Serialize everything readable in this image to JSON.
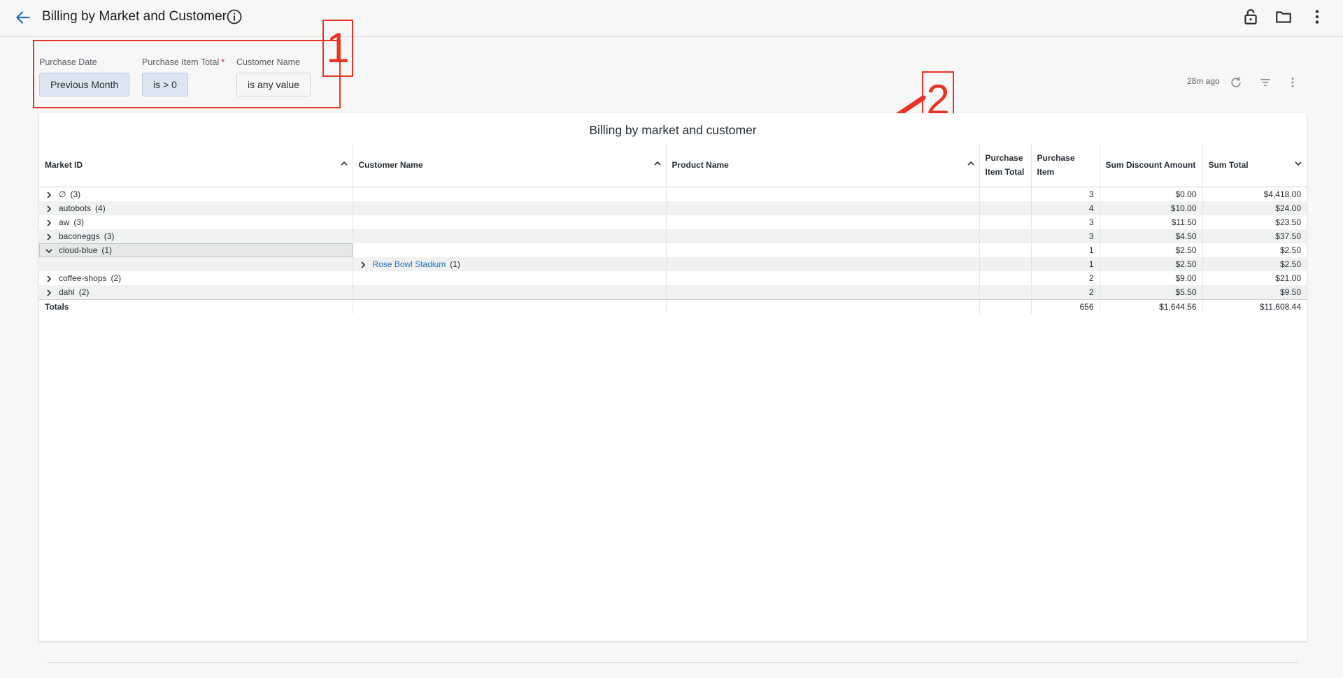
{
  "header": {
    "title": "Billing by Market and Customer",
    "icons": [
      "back-arrow-icon",
      "info-icon",
      "lock-open-icon",
      "folder-icon",
      "more-vertical-icon"
    ]
  },
  "filters": [
    {
      "label": "Purchase Date",
      "value": "Previous Month",
      "required": false,
      "active": true
    },
    {
      "label": "Purchase Item Total",
      "value": "is > 0",
      "required": true,
      "active": true
    },
    {
      "label": "Customer Name",
      "value": "is any value",
      "required": false,
      "active": false
    }
  ],
  "required_mark": "*",
  "annotations": {
    "one": "1",
    "two": "2"
  },
  "toolbar": {
    "updated": "28m ago",
    "icons": [
      "refresh-icon",
      "filter-icon",
      "more-vertical-icon"
    ]
  },
  "table": {
    "title": "Billing by market and customer",
    "columns": [
      "Market ID",
      "Customer Name",
      "Product Name",
      "Purchase Item Total",
      "Purchase Item",
      "Sum Discount Amount",
      "Sum Total"
    ],
    "rows": [
      {
        "market": "∅",
        "count": "(3)",
        "customer": "",
        "customer_count": "",
        "product": "",
        "pit": "",
        "items": "3",
        "discount": "$0.00",
        "total": "$4,418.00"
      },
      {
        "market": "autobots",
        "count": "(4)",
        "customer": "",
        "customer_count": "",
        "product": "",
        "pit": "",
        "items": "4",
        "discount": "$10.00",
        "total": "$24.00"
      },
      {
        "market": "aw",
        "count": "(3)",
        "customer": "",
        "customer_count": "",
        "product": "",
        "pit": "",
        "items": "3",
        "discount": "$11.50",
        "total": "$23.50"
      },
      {
        "market": "baconeggs",
        "count": "(3)",
        "customer": "",
        "customer_count": "",
        "product": "",
        "pit": "",
        "items": "3",
        "discount": "$4.50",
        "total": "$37.50"
      },
      {
        "market": "cloud-blue",
        "count": "(1)",
        "customer": "",
        "customer_count": "",
        "product": "",
        "pit": "",
        "items": "1",
        "discount": "$2.50",
        "total": "$2.50"
      },
      {
        "market": "",
        "count": "",
        "customer": "Rose Bowl Stadium",
        "customer_count": "(1)",
        "product": "",
        "pit": "",
        "items": "1",
        "discount": "$2.50",
        "total": "$2.50"
      },
      {
        "market": "coffee-shops",
        "count": "(2)",
        "customer": "",
        "customer_count": "",
        "product": "",
        "pit": "",
        "items": "2",
        "discount": "$9.00",
        "total": "$21.00"
      },
      {
        "market": "dahl",
        "count": "(2)",
        "customer": "",
        "customer_count": "",
        "product": "",
        "pit": "",
        "items": "2",
        "discount": "$5.50",
        "total": "$9.50"
      }
    ],
    "totals": {
      "label": "Totals",
      "items": "656",
      "discount": "$1,644.56",
      "total": "$11,608.44"
    }
  }
}
